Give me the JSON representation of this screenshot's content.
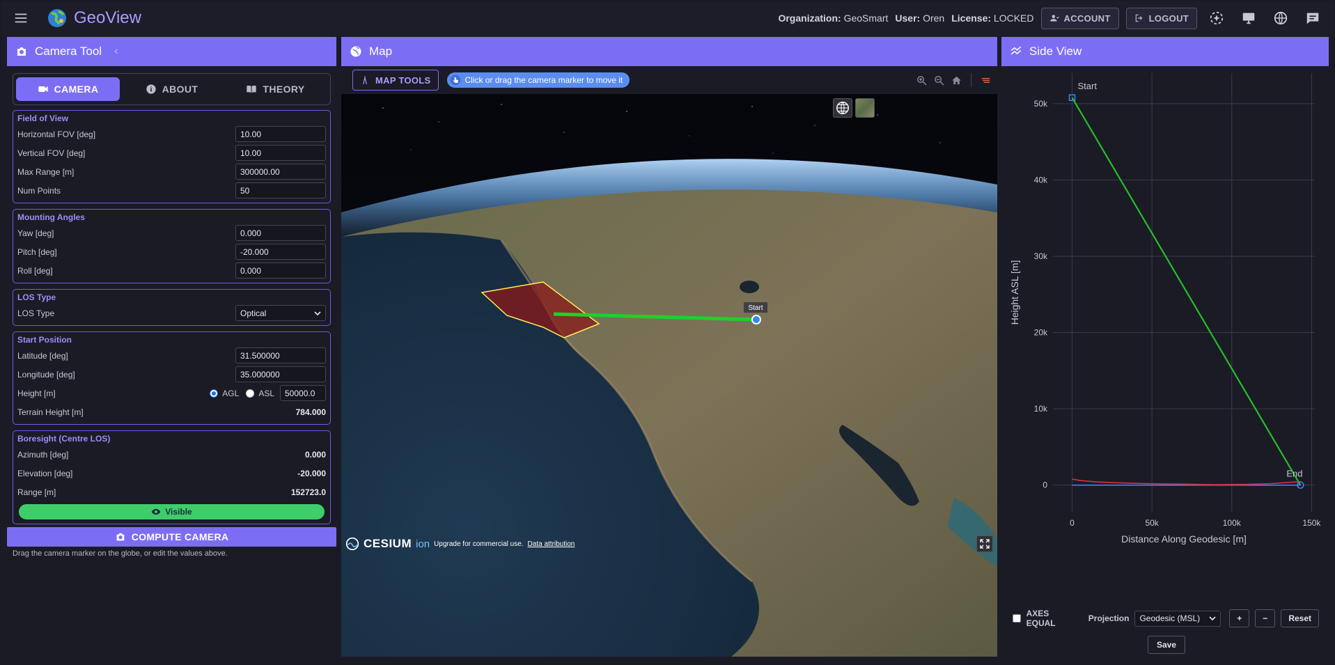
{
  "app": {
    "name": "GeoView",
    "org_label": "Organization:",
    "org_value": "GeoSmart",
    "user_label": "User:",
    "user_value": "Oren",
    "license_label": "License:",
    "license_value": "LOCKED",
    "account_label": "ACCOUNT",
    "logout_label": "LOGOUT"
  },
  "left_panel": {
    "title": "Camera Tool",
    "tabs": [
      {
        "label": "CAMERA",
        "icon": "video-camera-icon"
      },
      {
        "label": "ABOUT",
        "icon": "info-icon"
      },
      {
        "label": "THEORY",
        "icon": "book-icon"
      }
    ],
    "field_of_view": {
      "title": "Field of View",
      "rows": [
        {
          "label": "Horizontal FOV [deg]",
          "value": "10.00"
        },
        {
          "label": "Vertical FOV [deg]",
          "value": "10.00"
        },
        {
          "label": "Max Range [m]",
          "value": "300000.00"
        },
        {
          "label": "Num Points",
          "value": "50"
        }
      ]
    },
    "mounting": {
      "title": "Mounting Angles",
      "rows": [
        {
          "label": "Yaw [deg]",
          "value": "0.000"
        },
        {
          "label": "Pitch [deg]",
          "value": "-20.000"
        },
        {
          "label": "Roll [deg]",
          "value": "0.000"
        }
      ]
    },
    "los": {
      "title": "LOS Type",
      "label": "LOS Type",
      "selected": "Optical"
    },
    "start": {
      "title": "Start Position",
      "lat_label": "Latitude [deg]",
      "lat_value": "31.500000",
      "lon_label": "Longitude [deg]",
      "lon_value": "35.000000",
      "height_label": "Height [m]",
      "agl_label": "AGL",
      "asl_label": "ASL",
      "height_value": "50000.0",
      "terrain_label": "Terrain Height [m]",
      "terrain_value": "784.000"
    },
    "boresight": {
      "title": "Boresight (Centre LOS)",
      "az_label": "Azimuth [deg]",
      "az_value": "0.000",
      "el_label": "Elevation [deg]",
      "el_value": "-20.000",
      "range_label": "Range [m]",
      "range_value": "152723.0",
      "visible_label": "Visible"
    },
    "compute_label": "COMPUTE CAMERA",
    "hint": "Drag the camera marker on the globe, or edit the values above."
  },
  "map_panel": {
    "title": "Map",
    "map_tools_label": "MAP TOOLS",
    "hint": "Click or drag the camera marker to move it",
    "start_marker_label": "Start",
    "cesium_label": "CESIUM",
    "ion_label": "ion",
    "upgrade_text": "Upgrade for commercial use.",
    "attribution_text": "Data attribution"
  },
  "side_panel": {
    "title": "Side View",
    "axes_equal_label": "AXES EQUAL",
    "projection_label": "Projection",
    "projection_value": "Geodesic (MSL)",
    "plus_label": "+",
    "minus_label": "−",
    "reset_label": "Reset",
    "save_label": "Save"
  },
  "chart_data": {
    "type": "line",
    "xlabel": "Distance Along Geodesic [m]",
    "ylabel": "Height ASL [m]",
    "xlim": [
      -12000,
      152000
    ],
    "ylim": [
      -3500,
      54000
    ],
    "x_ticks": [
      0,
      50000,
      100000,
      150000
    ],
    "x_tick_labels": [
      "0",
      "50k",
      "100k",
      "150k"
    ],
    "y_ticks": [
      0,
      10000,
      20000,
      30000,
      40000,
      50000
    ],
    "y_tick_labels": [
      "0",
      "10k",
      "20k",
      "30k",
      "40k",
      "50k"
    ],
    "grid": true,
    "annotations": [
      {
        "text": "Start",
        "x": 0,
        "y": 50784
      },
      {
        "text": "End",
        "x": 143000,
        "y": 0
      }
    ],
    "series": [
      {
        "color": "#22c02a",
        "x": [
          0,
          143000
        ],
        "y": [
          50784,
          0
        ]
      },
      {
        "color": "#3a86ff",
        "x": [
          0,
          143000
        ],
        "y": [
          0,
          0
        ]
      },
      {
        "color": "#e0303a",
        "x": [
          0,
          5000,
          15000,
          30000,
          50000,
          70000,
          90000,
          110000,
          125000,
          135000,
          143000
        ],
        "y": [
          784,
          600,
          420,
          300,
          180,
          120,
          60,
          100,
          200,
          350,
          450
        ]
      }
    ],
    "markers": [
      {
        "shape": "square",
        "x": 0,
        "y": 50784,
        "color": "#3a86ff"
      },
      {
        "shape": "circle",
        "x": 143000,
        "y": 0,
        "color": "#3a86ff"
      }
    ]
  }
}
